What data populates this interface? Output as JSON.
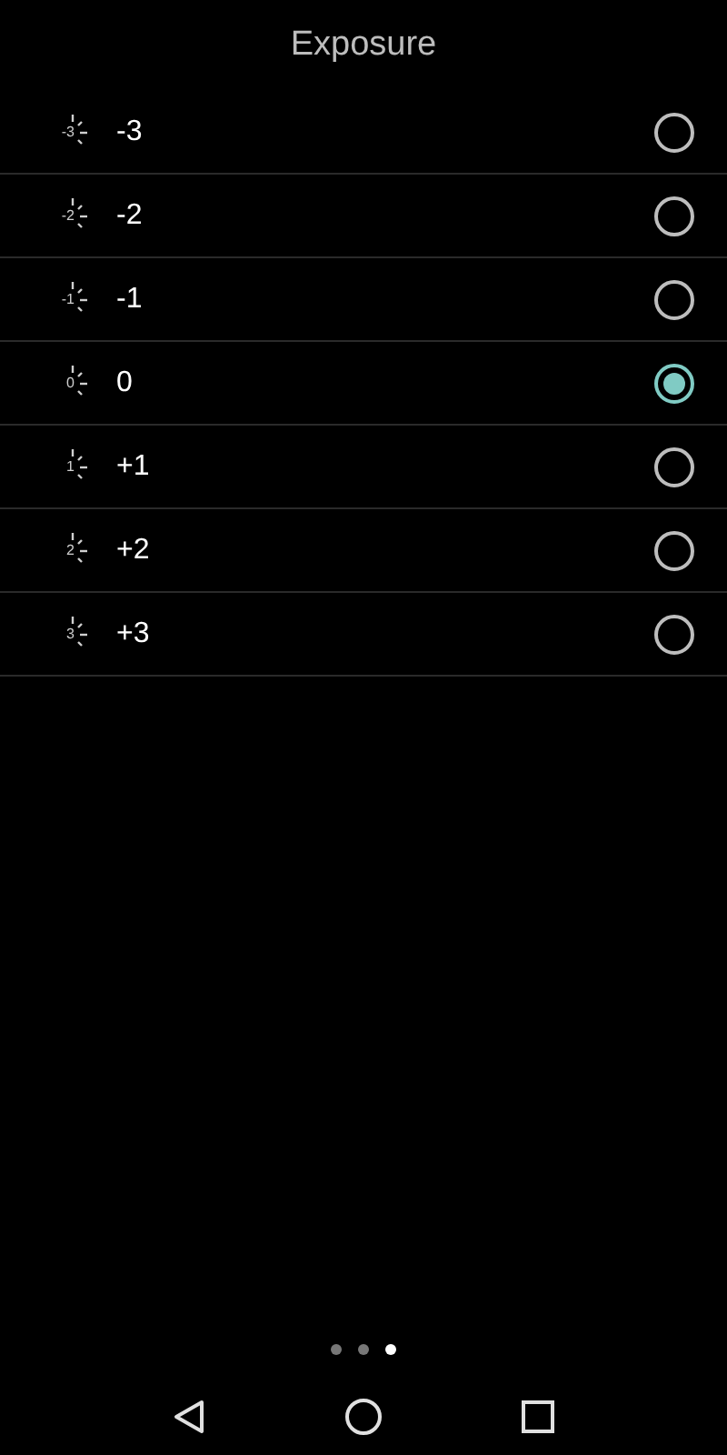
{
  "title": "Exposure",
  "options": [
    {
      "icon_label": "-3",
      "label": "-3",
      "selected": false
    },
    {
      "icon_label": "-2",
      "label": "-2",
      "selected": false
    },
    {
      "icon_label": "-1",
      "label": "-1",
      "selected": false
    },
    {
      "icon_label": "0",
      "label": "0",
      "selected": true
    },
    {
      "icon_label": "1",
      "label": "+1",
      "selected": false
    },
    {
      "icon_label": "2",
      "label": "+2",
      "selected": false
    },
    {
      "icon_label": "3",
      "label": "+3",
      "selected": false
    }
  ],
  "page_dots": [
    {
      "selected": false
    },
    {
      "selected": false
    },
    {
      "selected": true
    }
  ]
}
